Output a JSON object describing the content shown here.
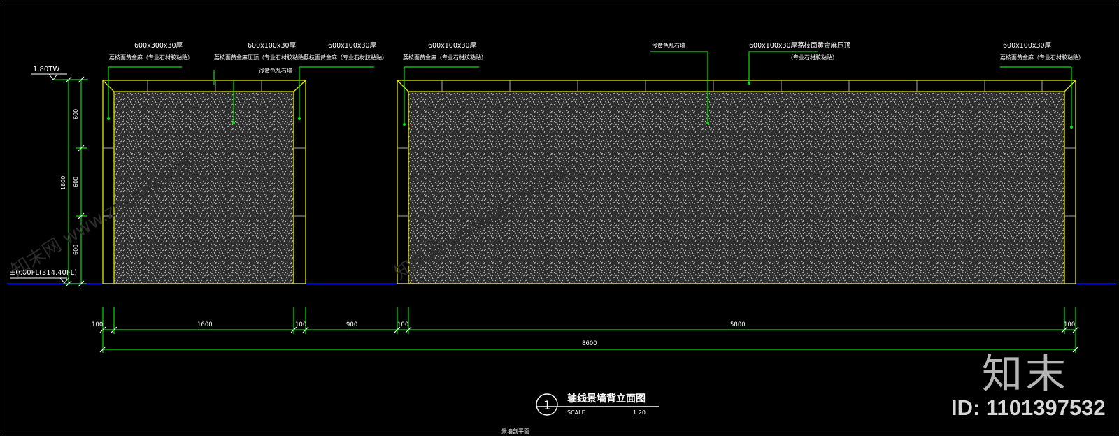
{
  "colors": {
    "background": "#000000",
    "wall_outline": "#e6e600",
    "leader": "#00e600",
    "dimension": "#00e600",
    "ground_line": "#0000ff",
    "text": "#ffffff",
    "texture": "#bfbfbf"
  },
  "level_labels": {
    "top": "1.80TW",
    "ground": "±0.00FL(314.40FL)"
  },
  "vertical_dims": {
    "total": "1800",
    "segments": [
      "600",
      "600",
      "600"
    ]
  },
  "annotations": [
    {
      "size": "600x300x30厚",
      "desc": "荔枝面黄金麻（专业石材胶粘贴）"
    },
    {
      "size": "600x100x30厚",
      "desc": "荔枝面黄金麻压顶（专业石材胶粘贴）",
      "desc2": "浅黄色乱石墙"
    },
    {
      "size": "600x100x30厚",
      "desc": "荔枝面黄金麻（专业石材胶粘贴）"
    },
    {
      "size": "600x100x30厚",
      "desc": "荔枝面黄金麻（专业石材胶粘贴）"
    },
    {
      "size": "",
      "desc": "浅黄色乱石墙"
    },
    {
      "size": "600x100x30厚荔枝面黄金麻压顶",
      "desc": "（专业石材胶粘贴）"
    },
    {
      "size": "600x100x30厚",
      "desc": "荔枝面黄金麻（专业石材胶粘贴）"
    }
  ],
  "horizontal_dims": {
    "segments": [
      "100",
      "1600",
      "100",
      "900",
      "100",
      "5800",
      "100"
    ],
    "total": "8600"
  },
  "title": {
    "number": "1",
    "text": "轴线景墙背立面图",
    "scale_label": "SCALE",
    "scale_value": "1:20",
    "subtitle": "景墙剖平面"
  },
  "watermark": {
    "logo_text": "知末",
    "id_text": "ID: 1101397532",
    "faint_text": "知末网 www.znzmo.com"
  }
}
